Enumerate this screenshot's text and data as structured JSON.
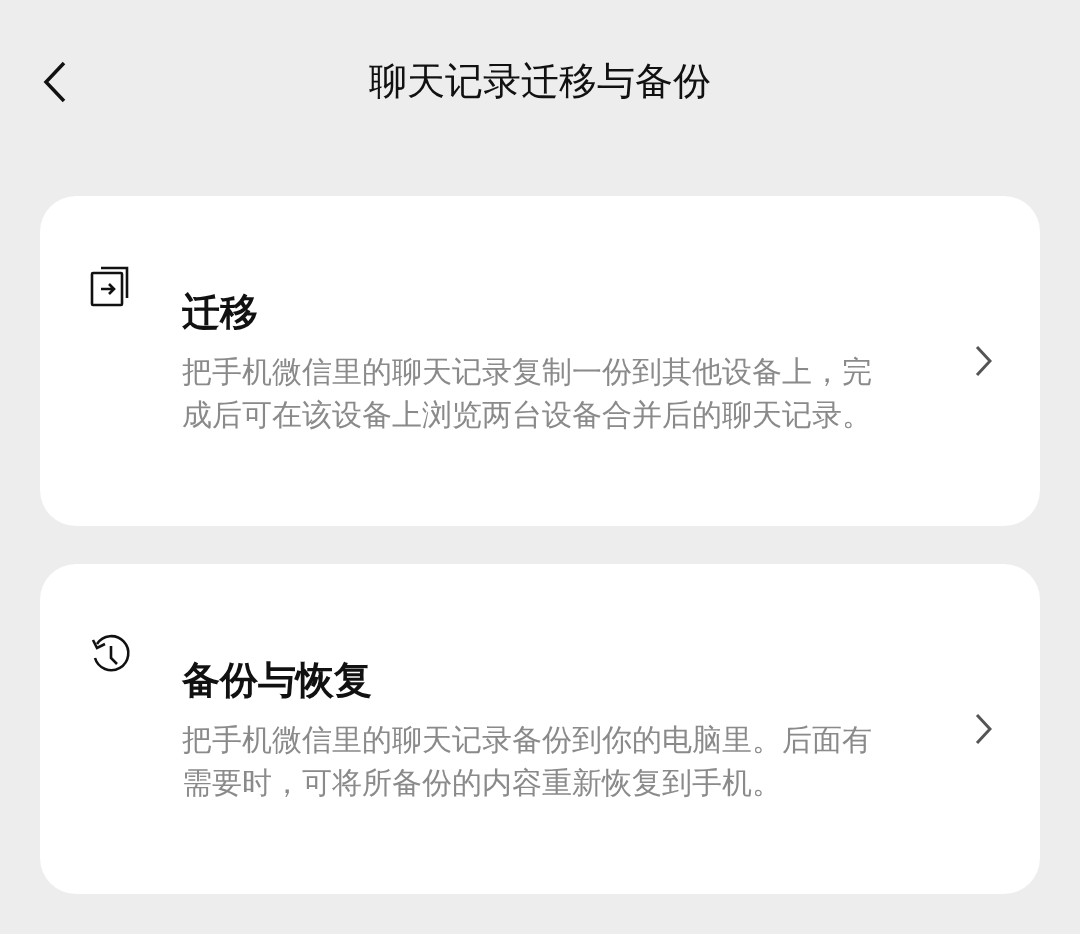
{
  "header": {
    "title": "聊天记录迁移与备份"
  },
  "options": [
    {
      "kind": "migrate",
      "title": "迁移",
      "description": "把手机微信里的聊天记录复制一份到其他设备上，完成后可在该设备上浏览两台设备合并后的聊天记录。"
    },
    {
      "kind": "backup",
      "title": "备份与恢复",
      "description": "把手机微信里的聊天记录备份到你的电脑里。后面有需要时，可将所备份的内容重新恢复到手机。"
    }
  ]
}
